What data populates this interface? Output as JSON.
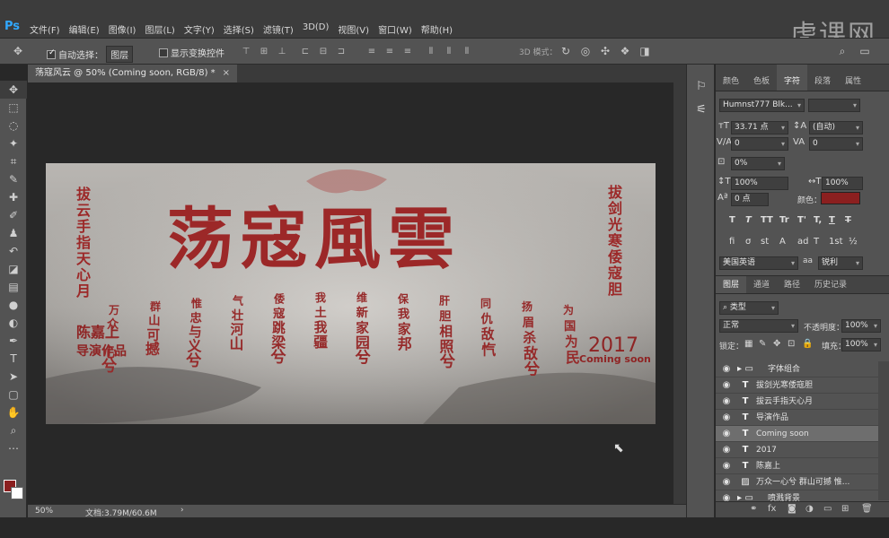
{
  "app": {
    "logo": "Ps"
  },
  "menu": [
    "文件(F)",
    "编辑(E)",
    "图像(I)",
    "图层(L)",
    "文字(Y)",
    "选择(S)",
    "滤镜(T)",
    "3D(D)",
    "视图(V)",
    "窗口(W)",
    "帮助(H)"
  ],
  "watermark": "虎课网",
  "options": {
    "auto_select_label": "自动选择：",
    "auto_select_value": "图层",
    "show_transform_label": "显示变换控件",
    "mode_3d_label": "3D 模式："
  },
  "document": {
    "tab_title": "荡寇风云 @ 50% (Coming soon, RGB/8) *",
    "close_glyph": "×",
    "zoom": "50%",
    "info": "文档:3.79M/60.6M"
  },
  "artwork": {
    "title": "荡寇風雲",
    "left_lines": [
      "拔",
      "云",
      "手",
      "指",
      "天",
      "心",
      "月"
    ],
    "right_lines": [
      "拔",
      "剑",
      "光",
      "寒",
      "倭",
      "寇",
      "胆"
    ],
    "director_line1": "陈嘉上",
    "director_line2": "导演作品",
    "year": "2017",
    "coming": "Coming soon",
    "poem_columns": [
      "万众一心兮",
      "群山可撼",
      "惟忠与义兮",
      "气壮河山",
      "倭寇跳梁兮",
      "我土我疆",
      "维新家园兮",
      "保我家邦",
      "肝胆相照兮",
      "同仇敌忾",
      "扬眉杀敌兮",
      "为国为民"
    ]
  },
  "character_panel": {
    "tabs": [
      "颜色",
      "色板",
      "字符",
      "段落",
      "属性"
    ],
    "active_tab": "字符",
    "font_family": "Humnst777 Blk...",
    "font_style": "",
    "font_size": "33.71 点",
    "leading": "(自动)",
    "kerning": "0",
    "tracking": "0",
    "tsume": "0%",
    "vertical_scale": "100%",
    "horizontal_scale": "100%",
    "baseline_shift": "0 点",
    "color_label": "颜色：",
    "text_color": "#8b1f1f",
    "style_buttons": [
      "T",
      "T",
      "TT",
      "Tr",
      "T'",
      "T,",
      "T",
      "T"
    ],
    "opentype_buttons": [
      "fi",
      "σ",
      "st",
      "A",
      "ad",
      "T",
      "1st",
      "½"
    ],
    "language": "美国英语",
    "antialias": "锐利"
  },
  "layers_panel": {
    "tabs": [
      "图层",
      "通道",
      "路径",
      "历史记录"
    ],
    "active_tab": "图层",
    "filter_kind": "类型",
    "blend_mode": "正常",
    "opacity_label": "不透明度：",
    "opacity_value": "100%",
    "lock_label": "锁定：",
    "fill_label": "填充：",
    "fill_value": "100%",
    "layers": [
      {
        "type": "group",
        "name": "字体组合",
        "selected": false
      },
      {
        "type": "text",
        "name": "拔剑光寒倭寇胆",
        "selected": false
      },
      {
        "type": "text",
        "name": "拔云手指天心月",
        "selected": false
      },
      {
        "type": "text",
        "name": "导演作品",
        "selected": false
      },
      {
        "type": "text",
        "name": "Coming soon",
        "selected": true
      },
      {
        "type": "text",
        "name": "2017",
        "selected": false
      },
      {
        "type": "text",
        "name": "陈嘉上",
        "selected": false
      },
      {
        "type": "image",
        "name": "万众一心兮 群山可撼  惟...",
        "selected": false
      },
      {
        "type": "group",
        "name": "喷溅背景",
        "selected": false
      }
    ]
  }
}
